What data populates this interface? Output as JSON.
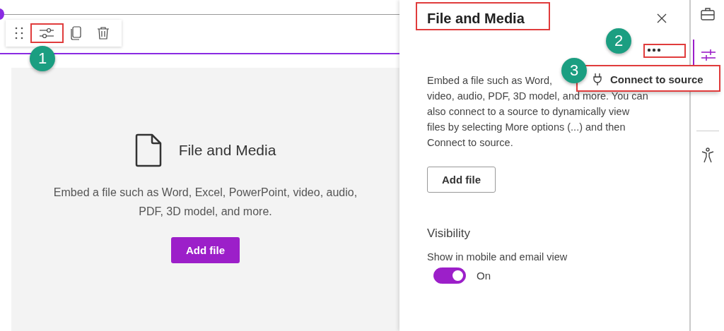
{
  "canvas": {
    "card": {
      "title": "File and Media",
      "description": "Embed a file such as Word, Excel, PowerPoint, video, audio, PDF, 3D model, and more.",
      "button": "Add file"
    }
  },
  "panel": {
    "title": "File and Media",
    "menu": {
      "items": [
        {
          "label": "Connect to source"
        }
      ]
    },
    "description_lines": [
      "Embed a file such as Word,",
      "video, audio, PDF, 3D model, and more. You can",
      "also connect to a source to dynamically view",
      "files by selecting More options (...) and then",
      "Connect to source."
    ],
    "add_button": "Add file",
    "section": "Visibility",
    "toggle": {
      "label": "Show in mobile and email view",
      "on": true,
      "state_label": "On"
    }
  },
  "rail": {
    "items": [
      {
        "kind": "briefcase",
        "selected": false
      },
      {
        "kind": "sliders",
        "selected": true
      },
      {
        "kind": "accessibility",
        "selected": false
      }
    ]
  },
  "annotations": [
    {
      "label": "1"
    },
    {
      "label": "2"
    },
    {
      "label": "3"
    }
  ]
}
